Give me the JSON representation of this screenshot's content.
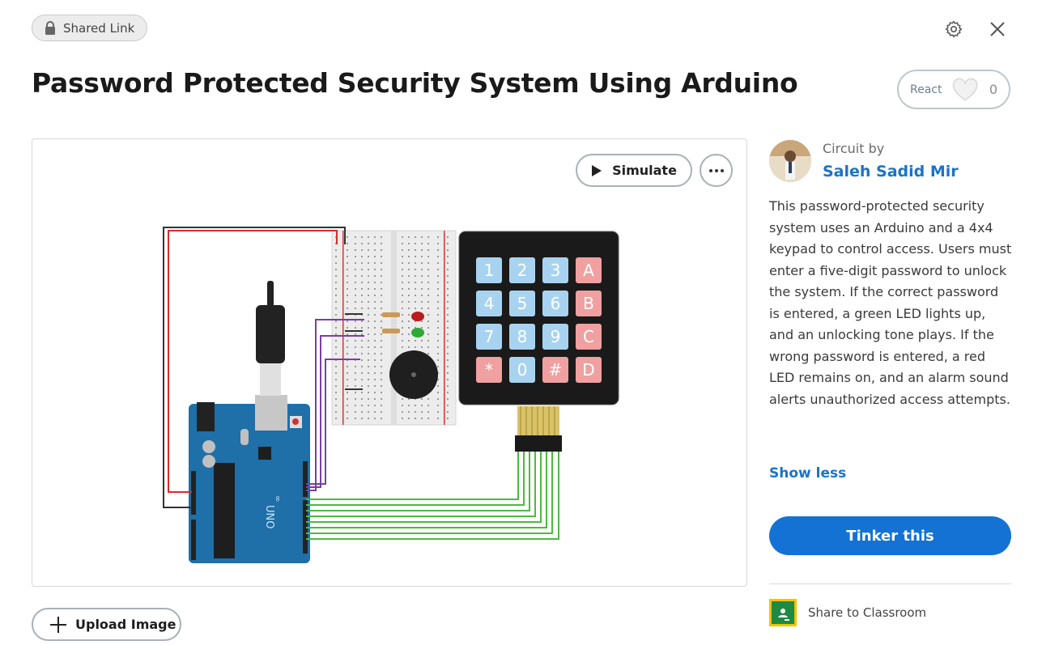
{
  "header": {
    "shared_label": "Shared Link",
    "title": "Password Protected Security System Using Arduino",
    "react_label": "React",
    "react_count": "0"
  },
  "canvas": {
    "simulate_label": "Simulate",
    "keypad_keys": [
      "1",
      "2",
      "3",
      "A",
      "4",
      "5",
      "6",
      "B",
      "7",
      "8",
      "9",
      "C",
      "*",
      "0",
      "#",
      "D"
    ],
    "arduino_label": "UNO"
  },
  "upload": {
    "label": "Upload Image"
  },
  "sidebar": {
    "circuit_by": "Circuit by",
    "author": "Saleh Sadid Mir",
    "description": "This password-protected security system uses an Arduino and a 4x4 keypad to control access. Users must enter a five-digit password to unlock the system. If the correct password is entered, a green LED lights up, and an unlocking tone plays. If the wrong password is entered, a red LED remains on, and an alarm sound alerts unauthorized access attempts.",
    "show_less": "Show less",
    "tinker_label": "Tinker this",
    "share_label": "Share to Classroom"
  },
  "colors": {
    "accent": "#1372d3",
    "link": "#1b73c9",
    "wire_green": "#4cbb3f",
    "wire_purple": "#7a3fa0",
    "wire_red": "#d92b2b",
    "key_blue": "#a8d3f0",
    "key_red": "#f0a0a0"
  },
  "icons": {
    "shared": "lock-icon",
    "settings": "gear-icon",
    "close": "close-icon",
    "react": "heart-icon",
    "simulate": "play-icon",
    "more": "more-icon",
    "upload": "plus-icon",
    "classroom": "classroom-icon"
  }
}
